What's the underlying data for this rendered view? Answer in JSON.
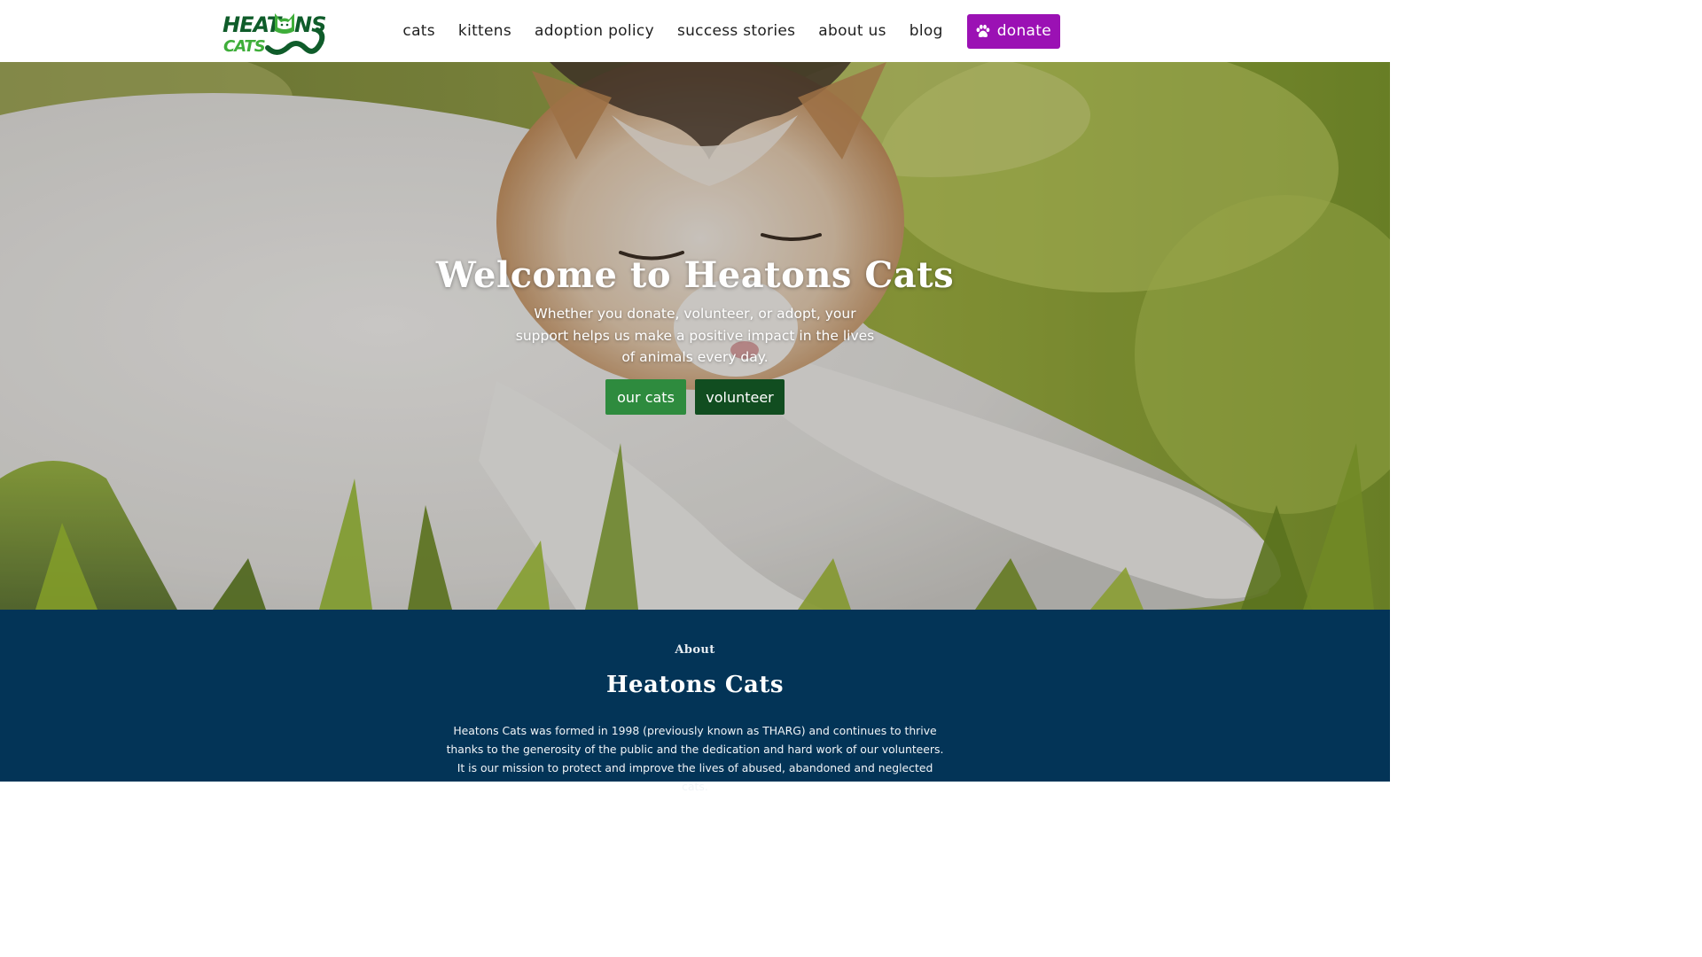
{
  "header": {
    "logo": {
      "line1": "HEAT",
      "line1_end": "NS",
      "line2": "CATS",
      "alt": "Heatons Cats logo",
      "colors": {
        "dark": "#0f5c2a",
        "light": "#3fae3a"
      }
    },
    "nav": {
      "items": [
        {
          "label": "cats"
        },
        {
          "label": "kittens"
        },
        {
          "label": "adoption policy"
        },
        {
          "label": "success stories"
        },
        {
          "label": "about us"
        },
        {
          "label": "blog"
        }
      ],
      "donate": {
        "label": "donate",
        "icon": "paw-icon",
        "color": "#9b11b4"
      }
    }
  },
  "hero": {
    "title": "Welcome to Heatons Cats",
    "subtitle": "Whether you donate, volunteer, or adopt, your support helps us make a positive impact in the lives of animals every day.",
    "buttons": {
      "primary": {
        "label": "our cats",
        "color": "#2e8b3e"
      },
      "secondary": {
        "label": "volunteer",
        "color": "#114d20"
      }
    }
  },
  "about": {
    "eyebrow": "About",
    "title": "Heatons Cats",
    "text": "Heatons Cats was formed in 1998 (previously known as THARG) and continues to thrive thanks to the generosity of the public and the dedication and hard work of our volunteers. It is our mission to protect and improve the lives of abused, abandoned and neglected cats.",
    "background": "#033457"
  }
}
